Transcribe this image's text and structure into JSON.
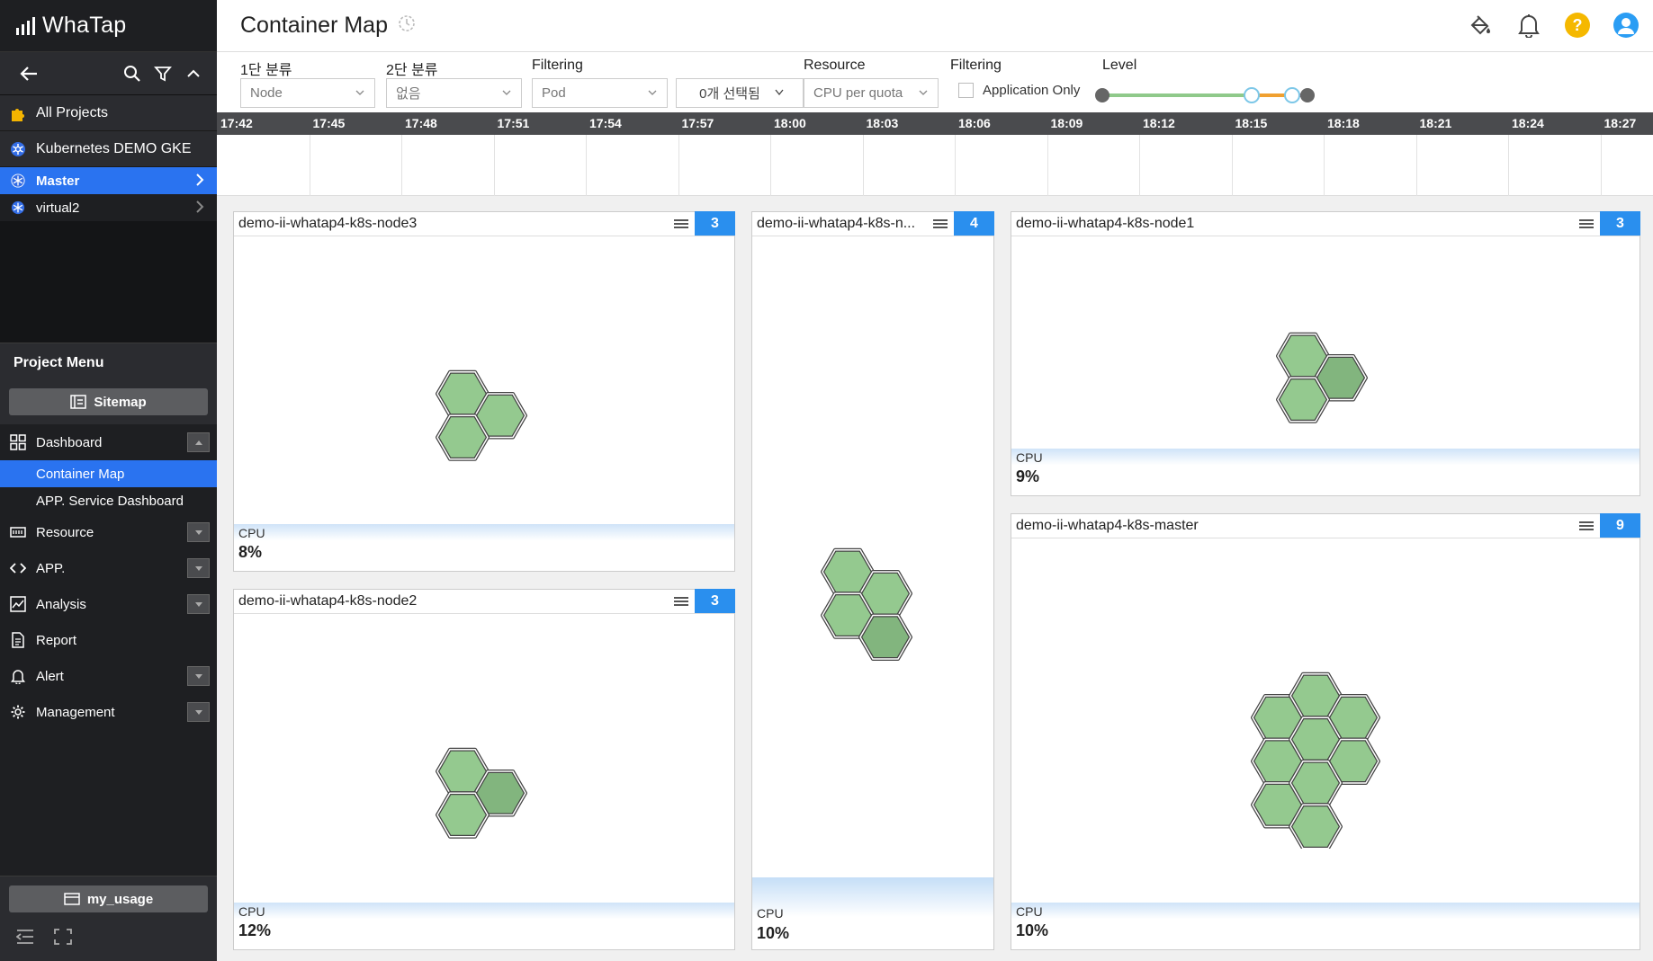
{
  "app": {
    "brand": "WhaTap"
  },
  "sidebar": {
    "all_projects": "All Projects",
    "project_name": "Kubernetes DEMO GKE",
    "tree": [
      {
        "label": "Master",
        "active": true
      },
      {
        "label": "virtual2",
        "active": false
      }
    ],
    "project_menu_title": "Project Menu",
    "sitemap_label": "Sitemap",
    "menu": {
      "dashboard": "Dashboard",
      "container_map": "Container Map",
      "app_service_dashboard": "APP. Service Dashboard",
      "resource": "Resource",
      "app": "APP.",
      "analysis": "Analysis",
      "report": "Report",
      "alert": "Alert",
      "management": "Management"
    },
    "my_usage_label": "my_usage"
  },
  "header": {
    "title": "Container Map"
  },
  "filters": {
    "group1_label": "1단 분류",
    "group1_value": "Node",
    "group2_label": "2단 분류",
    "group2_value": "없음",
    "filtering_label": "Filtering",
    "filtering_value": "Pod",
    "selected_value": "0개 선택됨",
    "resource_label": "Resource",
    "resource_value": "CPU per quota",
    "filtering2_label": "Filtering",
    "app_only_label": "Application Only",
    "level_label": "Level"
  },
  "timeline": {
    "ticks": [
      "17:42",
      "17:45",
      "17:48",
      "17:51",
      "17:54",
      "17:57",
      "18:00",
      "18:03",
      "18:06",
      "18:09",
      "18:12",
      "18:15",
      "18:18",
      "18:21",
      "18:24",
      "18:27"
    ]
  },
  "nodes": {
    "node3": {
      "title": "demo-ii-whatap4-k8s-node3",
      "count": "3",
      "metric_label": "CPU",
      "metric_value": "8%"
    },
    "node2": {
      "title": "demo-ii-whatap4-k8s-node2",
      "count": "3",
      "metric_label": "CPU",
      "metric_value": "12%"
    },
    "nodeN": {
      "title": "demo-ii-whatap4-k8s-n...",
      "count": "4",
      "metric_label": "CPU",
      "metric_value": "10%"
    },
    "node1": {
      "title": "demo-ii-whatap4-k8s-node1",
      "count": "3",
      "metric_label": "CPU",
      "metric_value": "9%"
    },
    "master": {
      "title": "demo-ii-whatap4-k8s-master",
      "count": "9",
      "metric_label": "CPU",
      "metric_value": "10%"
    }
  },
  "colors": {
    "accent": "#2a73f0",
    "badge": "#2a8fee",
    "hex_fill": "#94c98f",
    "hex_fill_dark": "#82b57e",
    "sidebar_bg": "#1e1f22"
  }
}
